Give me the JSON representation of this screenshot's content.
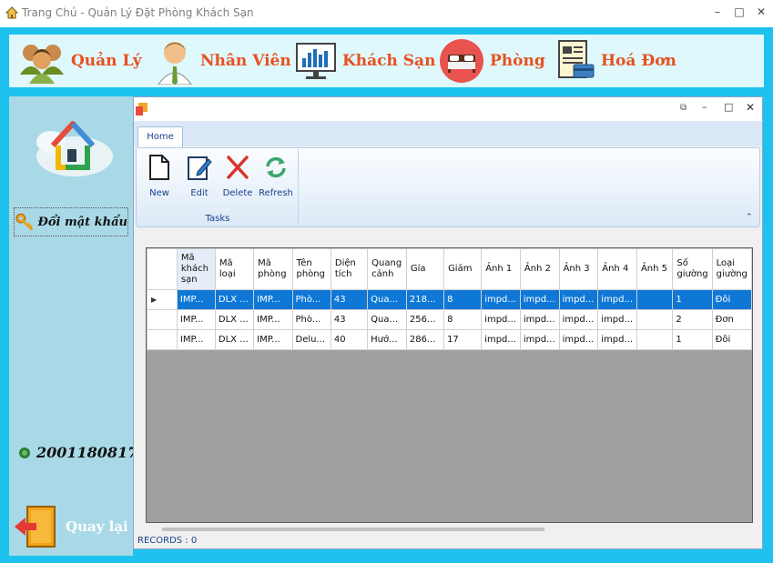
{
  "window": {
    "title": "Trang Chủ - Quản Lý Đặt Phòng Khách Sạn",
    "controls": {
      "minimize": "–",
      "maximize": "□",
      "close": "✕"
    }
  },
  "menu": {
    "items": [
      {
        "label": "Quản Lý",
        "icon": "people-icon"
      },
      {
        "label": "Nhân Viên",
        "icon": "staff-icon"
      },
      {
        "label": "Khách Sạn",
        "icon": "hotel-chart-icon"
      },
      {
        "label": "Phòng",
        "icon": "bed-icon"
      },
      {
        "label": "Hoá Đơn",
        "icon": "invoice-icon"
      }
    ]
  },
  "sidebar": {
    "change_password": "Đổi mật khẩu",
    "user_id": "2001180817",
    "back": "Quay lại"
  },
  "ribbon": {
    "tab_home": "Home",
    "buttons": {
      "new": "New",
      "edit": "Edit",
      "delete": "Delete",
      "refresh": "Refresh"
    },
    "group_label": "Tasks"
  },
  "grid": {
    "columns": [
      "Mã khách sạn",
      "Mã loại",
      "Mã phòng",
      "Tên phòng",
      "Diện tích",
      "Quang cảnh",
      "Gía",
      "Giảm",
      "Ảnh 1",
      "Ảnh 2",
      "Ảnh 3",
      "Ảnh 4",
      "Ảnh 5",
      "Số giường",
      "Loại giường"
    ],
    "rows": [
      [
        "IMP...",
        "DLX ...",
        "IMP...",
        "Phò...",
        "43",
        "Qua...",
        "218...",
        "8",
        "impd...",
        "impd...",
        "impd...",
        "impd...",
        "",
        "1",
        "Đôi"
      ],
      [
        "IMP...",
        "DLX ...",
        "IMP...",
        "Phò...",
        "43",
        "Qua...",
        "256...",
        "8",
        "impd...",
        "impd...",
        "impd...",
        "impd...",
        "",
        "2",
        "Đơn"
      ],
      [
        "IMP...",
        "DLX ...",
        "IMP...",
        "Delu...",
        "40",
        "Hướ...",
        "286...",
        "17",
        "impd...",
        "impd...",
        "impd...",
        "impd...",
        "",
        "1",
        "Đôi"
      ]
    ],
    "selected_row": 0
  },
  "status": {
    "records": "RECORDS : 0"
  },
  "colors": {
    "frame": "#1ec2ee",
    "menu_bg": "#dff8fc",
    "menu_text": "#e8501f",
    "sidebar": "#a9d9e6",
    "selection": "#0f78d7"
  }
}
